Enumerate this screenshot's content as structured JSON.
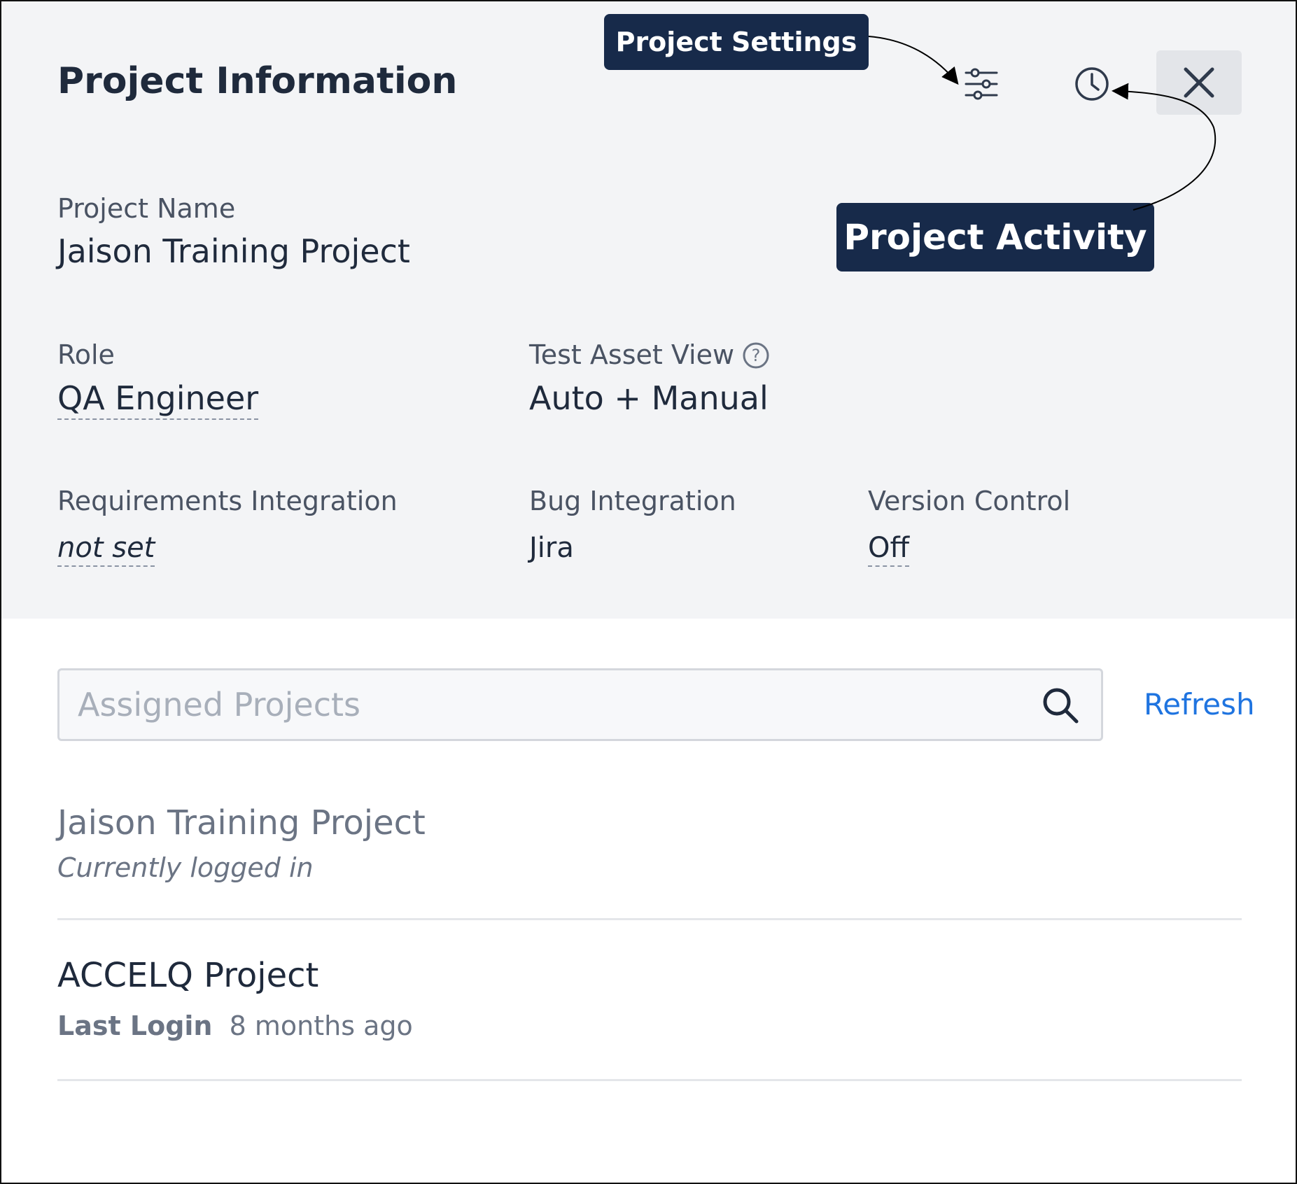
{
  "header": {
    "title": "Project Information"
  },
  "toolbar": {
    "settings_icon": "sliders-icon",
    "history_icon": "clock-history-icon",
    "close_icon": "close-icon"
  },
  "callouts": {
    "settings": "Project Settings",
    "activity": "Project Activity"
  },
  "project": {
    "name_label": "Project Name",
    "name_value": "Jaison Training Project",
    "role_label": "Role",
    "role_value": "QA Engineer",
    "asset_view_label": "Test Asset View",
    "asset_view_value": "Auto + Manual",
    "requirements_label": "Requirements Integration",
    "requirements_value": "not set",
    "bug_label": "Bug Integration",
    "bug_value": "Jira",
    "vcs_label": "Version Control",
    "vcs_value": "Off"
  },
  "search": {
    "placeholder": "Assigned Projects",
    "value": "",
    "refresh_label": "Refresh"
  },
  "assigned_projects": [
    {
      "name": "Jaison Training Project",
      "status": "Currently logged in"
    },
    {
      "name": "ACCELQ Project",
      "last_login_label": "Last Login",
      "last_login_value": "8 months ago"
    }
  ],
  "colors": {
    "panel_bg": "#f3f4f6",
    "callout_bg": "#172a4a",
    "link": "#1f74e0",
    "text_dark": "#1f2a3c",
    "text_muted": "#6b7484"
  }
}
